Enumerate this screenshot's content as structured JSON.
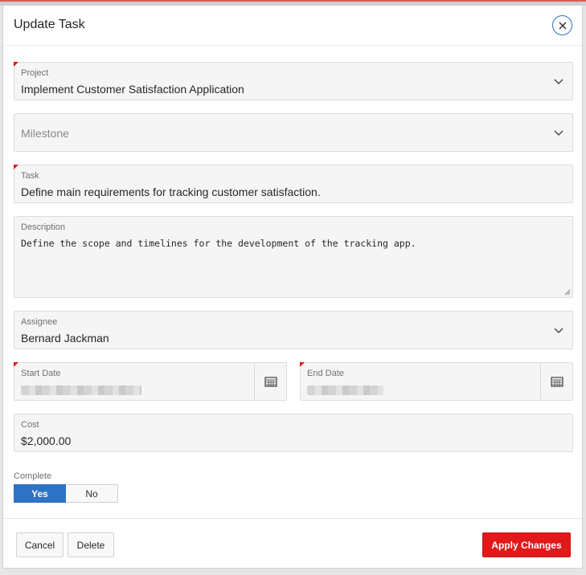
{
  "dialog": {
    "title": "Update Task",
    "close_icon": "close-icon"
  },
  "fields": {
    "project": {
      "label": "Project",
      "value": "Implement Customer Satisfaction Application",
      "required": true
    },
    "milestone": {
      "placeholder": "Milestone"
    },
    "task": {
      "label": "Task",
      "value": "Define main requirements for tracking customer satisfaction.",
      "required": true
    },
    "description": {
      "label": "Description",
      "value": "Define the scope and timelines for the development of the tracking app."
    },
    "assignee": {
      "label": "Assignee",
      "value": "Bernard Jackman"
    },
    "start_date": {
      "label": "Start Date",
      "required": true
    },
    "end_date": {
      "label": "End Date",
      "required": true
    },
    "cost": {
      "label": "Cost",
      "value": "$2,000.00"
    },
    "complete": {
      "label": "Complete",
      "options": [
        "Yes",
        "No"
      ],
      "selected": "Yes"
    }
  },
  "footer": {
    "cancel_label": "Cancel",
    "delete_label": "Delete",
    "apply_label": "Apply Changes"
  },
  "colors": {
    "accent": "#2d72c4",
    "primary_button": "#e0191b",
    "required_marker": "#e0191b"
  }
}
